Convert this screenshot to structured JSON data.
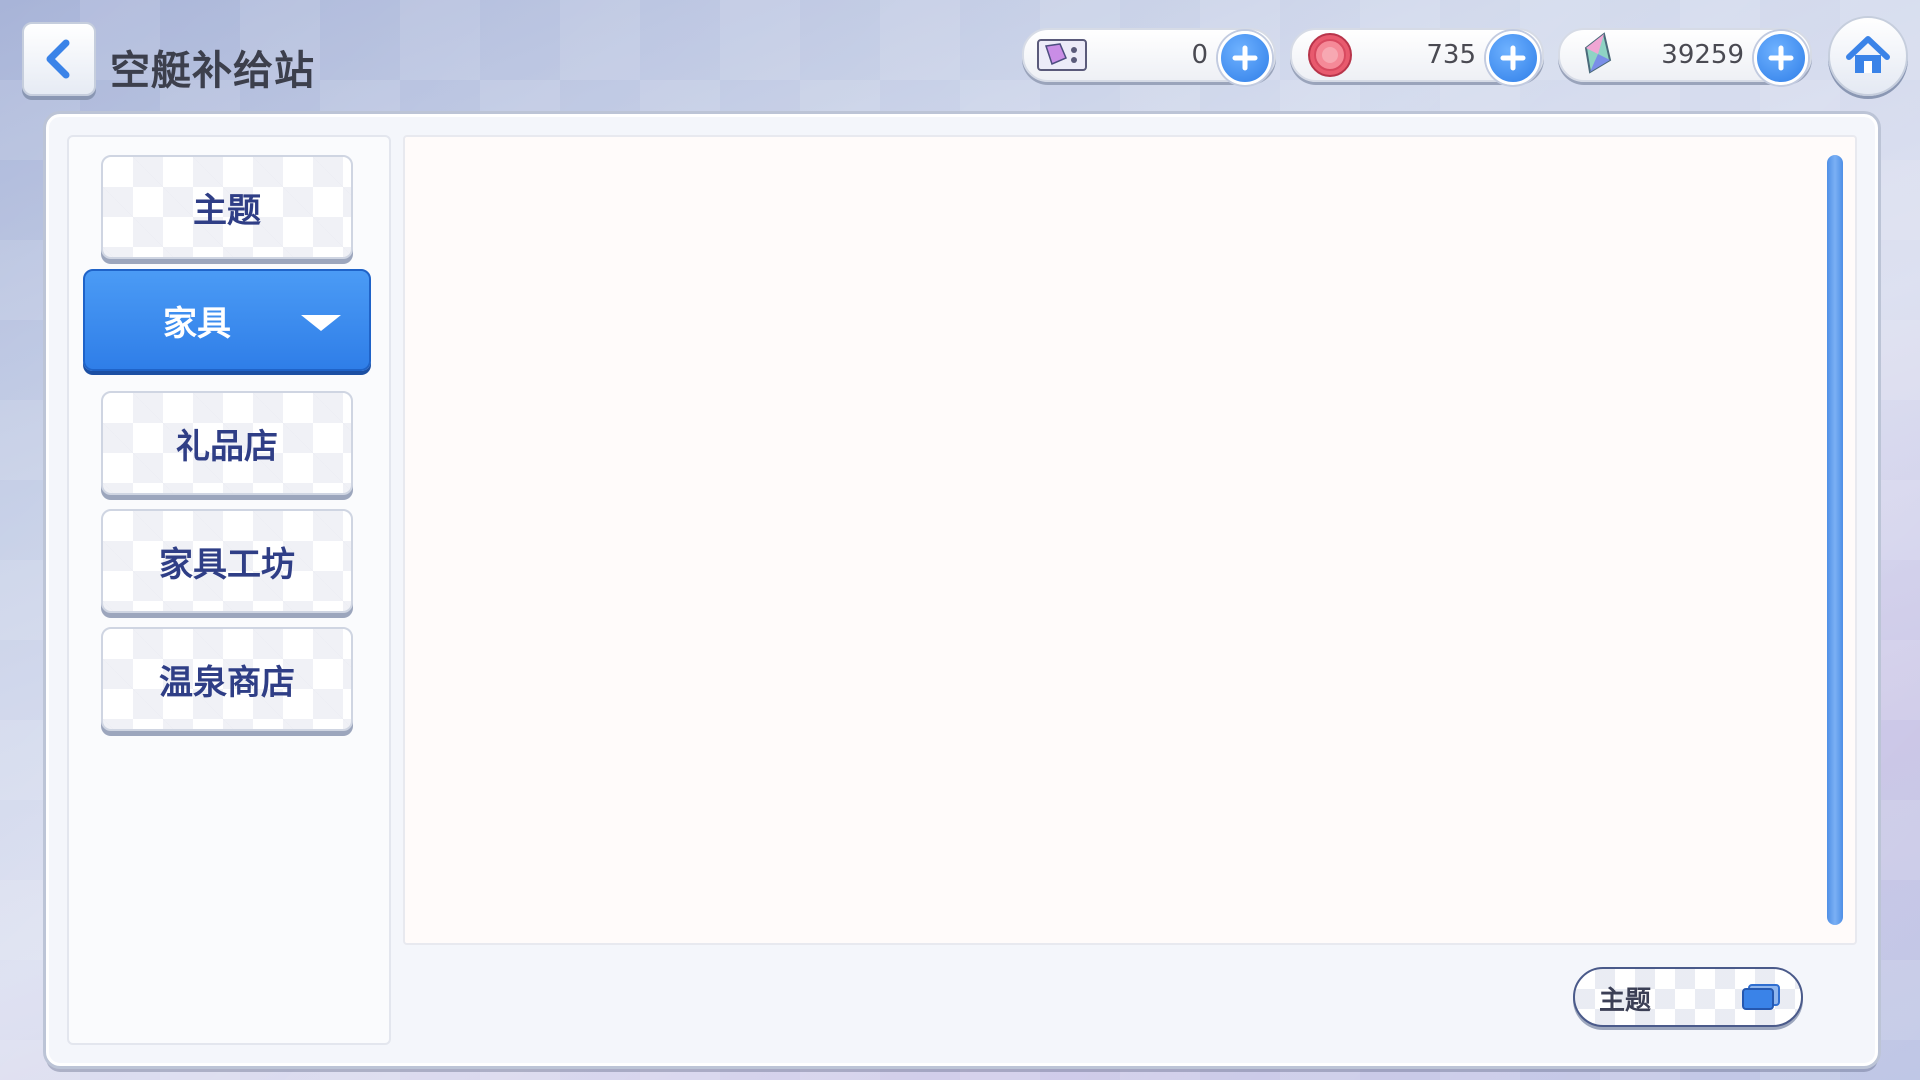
{
  "header": {
    "title": "空艇补给站"
  },
  "currencies": [
    {
      "name": "ticket",
      "icon": "ticket-icon",
      "value": "0"
    },
    {
      "name": "coin",
      "icon": "coin-icon",
      "value": "735"
    },
    {
      "name": "gem",
      "icon": "crystal-icon",
      "value": "39259"
    }
  ],
  "sidebar": {
    "items": [
      {
        "label": "主题"
      },
      {
        "label": "家具",
        "active": true
      },
      {
        "label": "礼品店"
      },
      {
        "label": "家具工坊"
      },
      {
        "label": "温泉商店"
      }
    ]
  },
  "filter": {
    "label": "主题"
  },
  "colors": {
    "accent": "#2f7ee8",
    "tab_text": "#2f3e86",
    "content_bg": "#fffbfa"
  }
}
